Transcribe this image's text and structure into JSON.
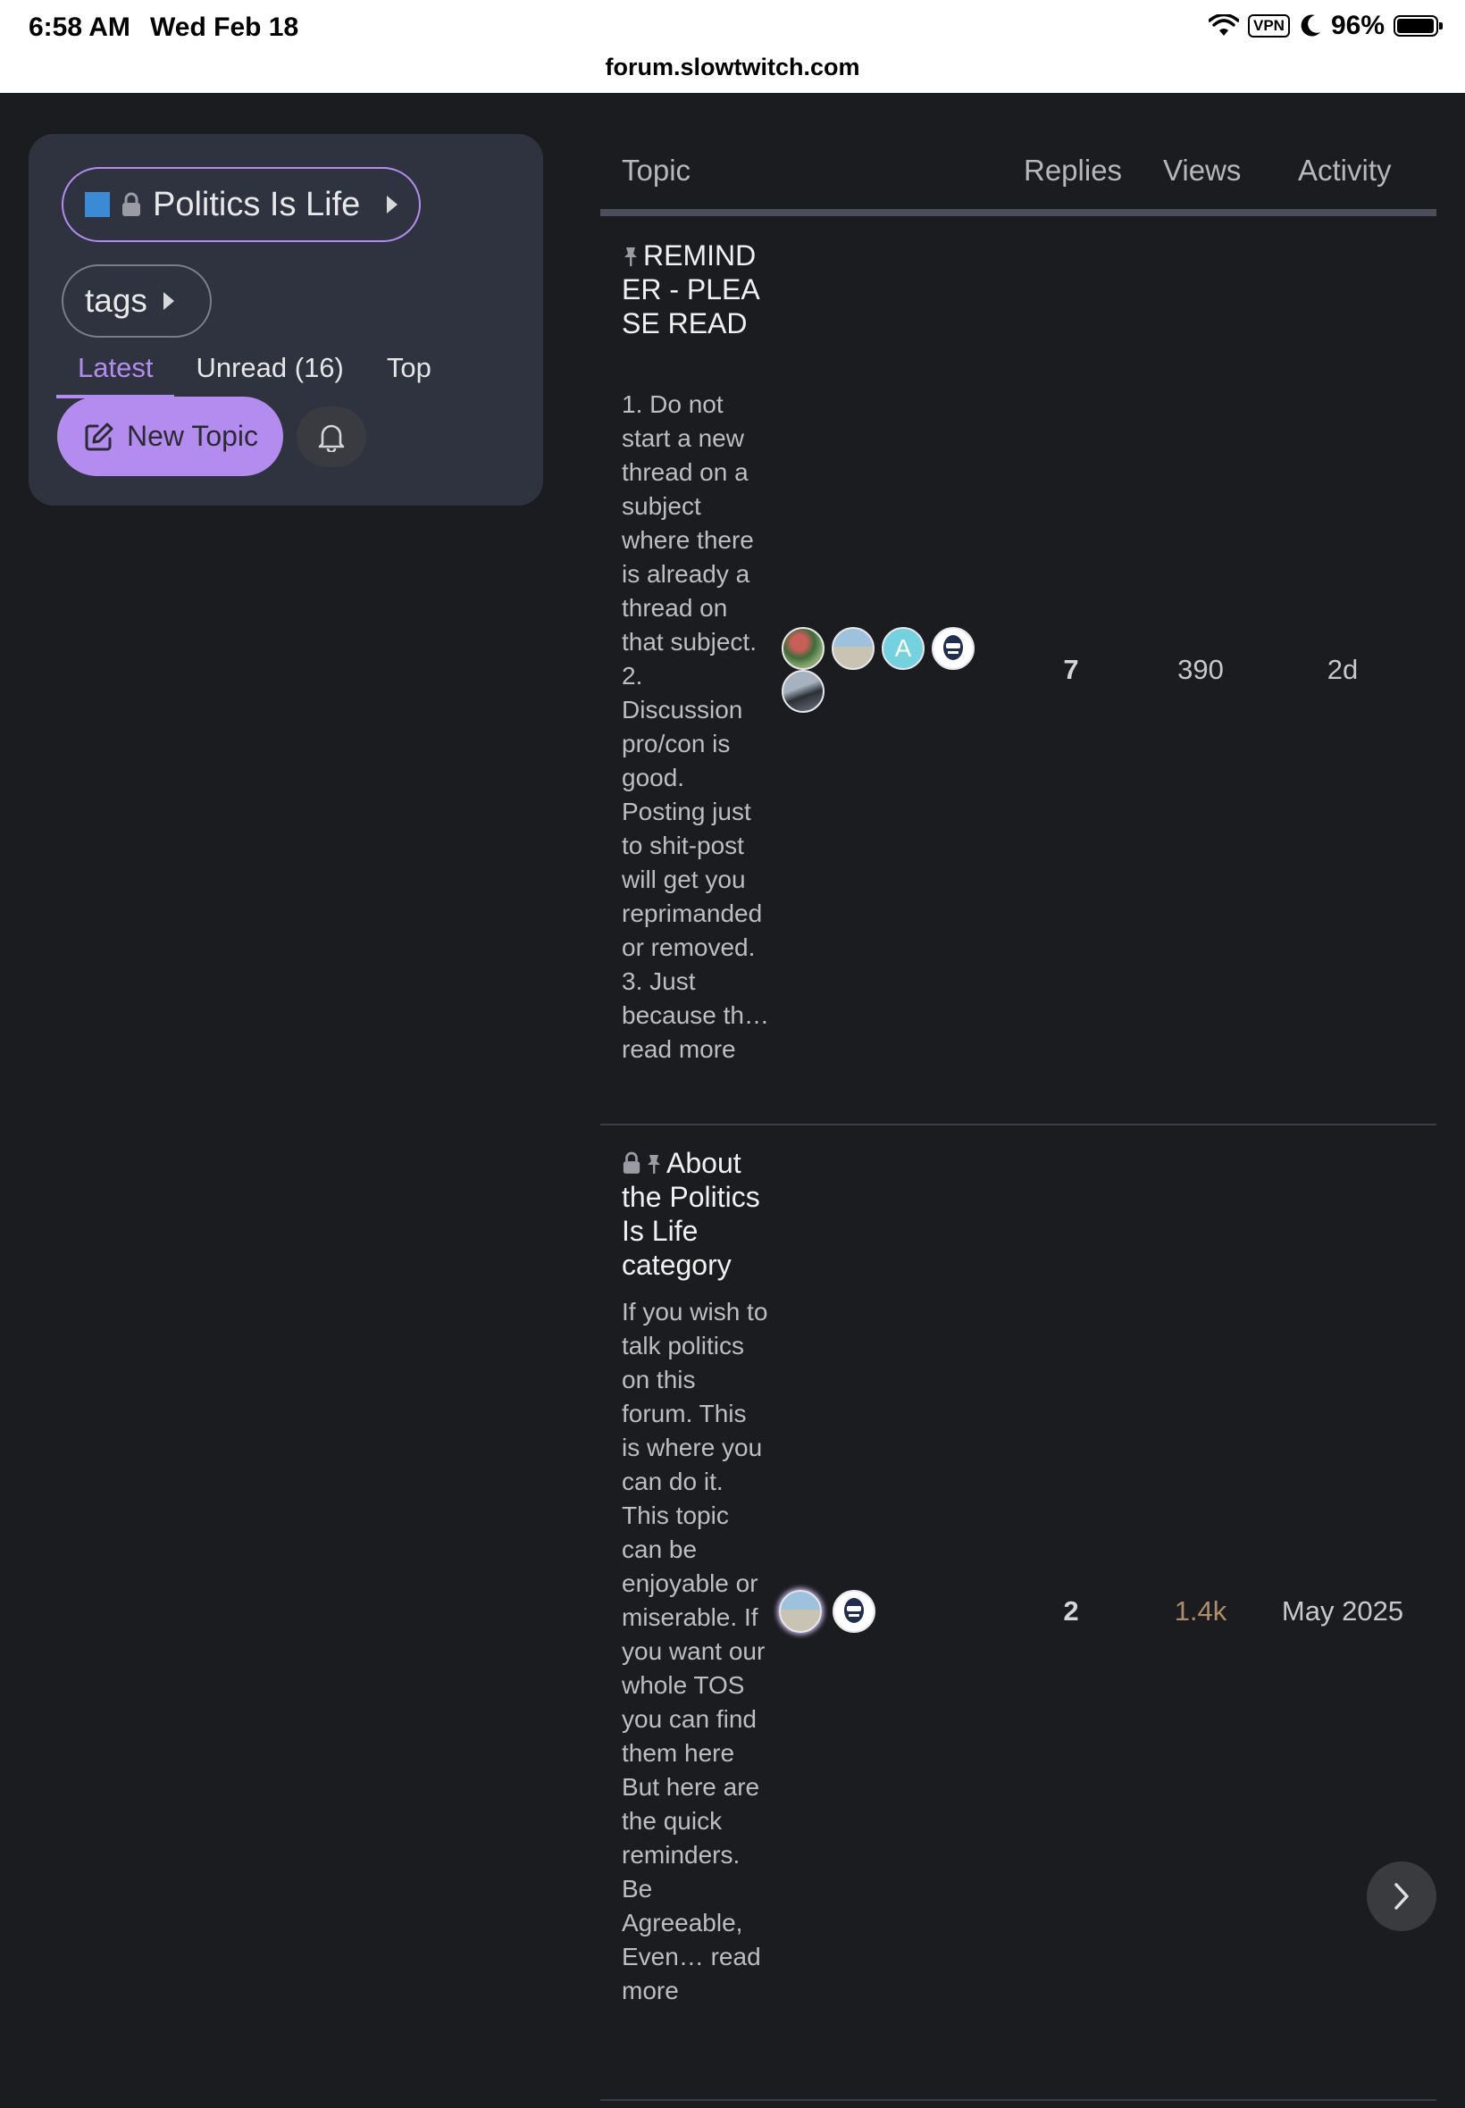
{
  "status_bar": {
    "time": "6:58 AM",
    "date": "Wed Feb 18",
    "vpn": "VPN",
    "battery": "96%",
    "url": "forum.slowtwitch.com"
  },
  "sidebar": {
    "category": "Politics Is Life",
    "category_color": "#3a8ad6",
    "tags_label": "tags",
    "tabs": [
      {
        "label": "Latest",
        "active": true
      },
      {
        "label": "Unread (16)",
        "active": false
      },
      {
        "label": "Top",
        "active": false
      }
    ],
    "new_topic_label": "New Topic"
  },
  "table": {
    "headers": {
      "topic": "Topic",
      "replies": "Replies",
      "views": "Views",
      "activity": "Activity"
    },
    "rows": [
      {
        "title": "REMINDER - PLEASE READ",
        "pinned": true,
        "locked": false,
        "excerpt": "1. Do not start a new thread on a subject where there is already a thread on that subject. 2. Discussion pro/con is good. Posting just to shit-post will get you reprimanded or removed. 3. Just because th… read more",
        "avatar_letter": "A",
        "replies": "7",
        "views": "390",
        "activity": "2d"
      },
      {
        "title": "About the Politics Is Life category",
        "pinned": true,
        "locked": true,
        "excerpt": "If you wish to talk politics on this forum. This is where you can do it. This topic can be enjoyable or miserable. If you want our whole TOS you can find them here But here are the quick reminders. Be Agreeable, Even… read more",
        "replies": "2",
        "views": "1.4k",
        "activity": "May 2025"
      }
    ]
  }
}
